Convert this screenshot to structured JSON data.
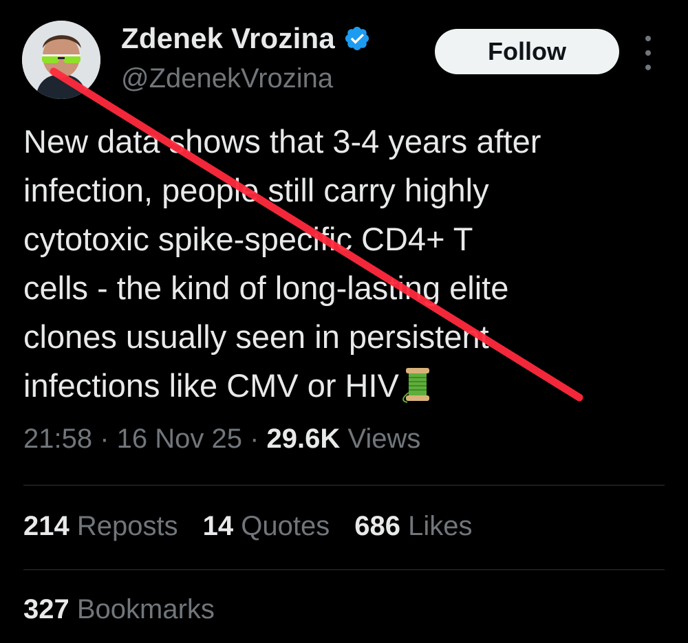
{
  "author": {
    "display_name": "Zdenek Vrozina",
    "handle": "@ZdenekVrozina",
    "verified": true,
    "verified_icon": "verified-badge-icon",
    "verified_color": "#1d9bf0"
  },
  "header": {
    "follow_label": "Follow",
    "more_icon": "more-vertical-icon"
  },
  "tweet": {
    "lines": [
      "New data shows that 3-4 years after",
      "infection, people still carry highly",
      "cytotoxic spike-specific CD4+ T",
      "cells - the kind of long-lasting elite",
      "clones usually seen in persistent",
      "infections like CMV or HIV"
    ],
    "emoji": "spool-of-thread-emoji"
  },
  "meta": {
    "time": "21:58",
    "separator": " · ",
    "date": "16 Nov 25",
    "views_count": "29.6K",
    "views_label": "Views"
  },
  "stats": {
    "reposts_count": "214",
    "reposts_label": "Reposts",
    "quotes_count": "14",
    "quotes_label": "Quotes",
    "likes_count": "686",
    "likes_label": "Likes",
    "bookmarks_count": "327",
    "bookmarks_label": "Bookmarks"
  },
  "colors": {
    "background": "#000000",
    "text_primary": "#e7e9ea",
    "text_secondary": "#71767b",
    "divider": "#2f3336",
    "strike_line": "#ff2a3d"
  }
}
